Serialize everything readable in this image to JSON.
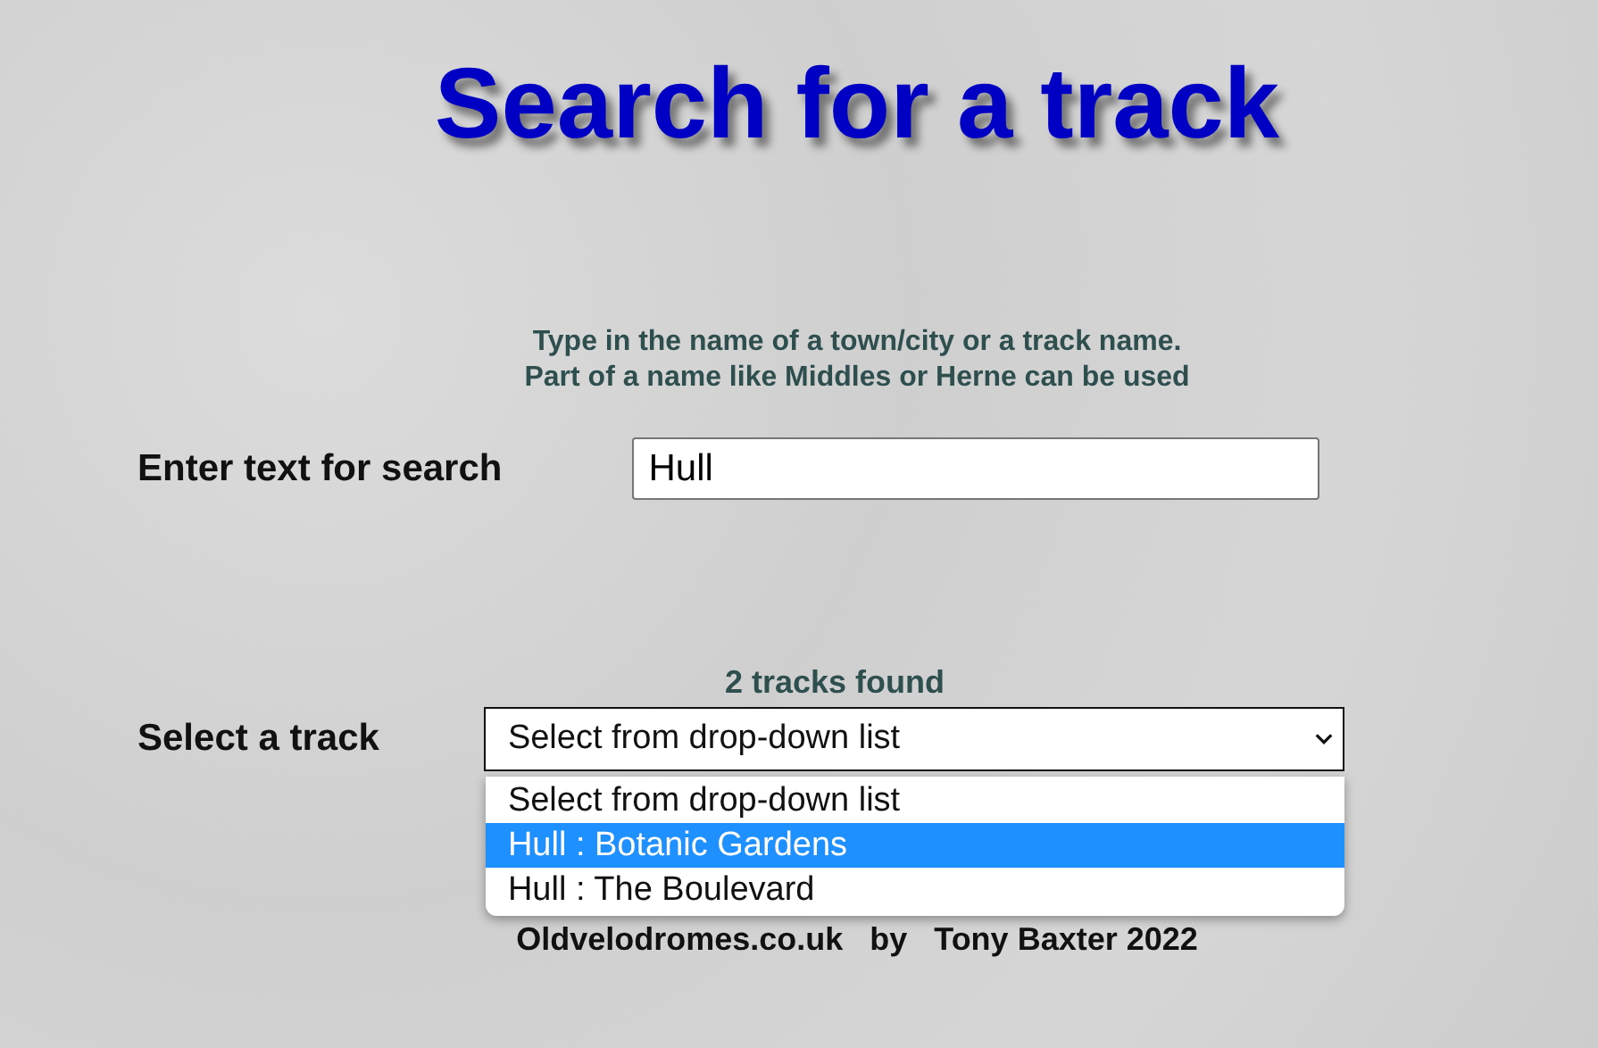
{
  "title": "Search for a track",
  "instructions": [
    "Type in the name of a town/city or a track name.",
    "Part of a name like Middles or Herne can be used"
  ],
  "search": {
    "label": "Enter text for search",
    "value": "Hull"
  },
  "result_count": "2 tracks found",
  "track_select": {
    "label": "Select a track",
    "value": "Select from drop-down list",
    "expanded": true,
    "options": [
      {
        "label": "Select from drop-down list",
        "highlighted": false
      },
      {
        "label": "Hull : Botanic Gardens",
        "highlighted": true
      },
      {
        "label": "Hull : The Boulevard",
        "highlighted": false
      }
    ]
  },
  "footer": "Oldvelodromes.co.uk   by   Tony Baxter 2022"
}
